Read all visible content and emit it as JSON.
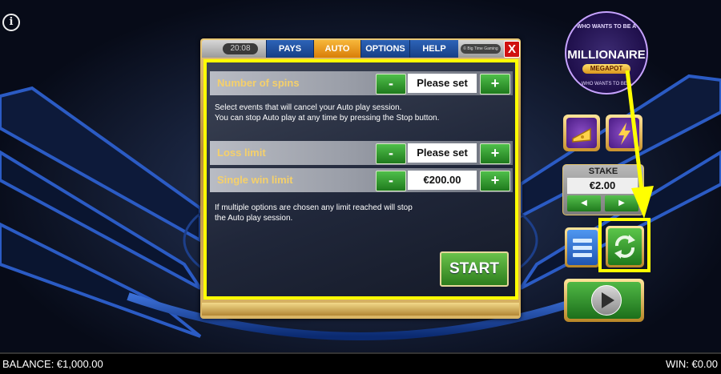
{
  "header": {
    "info_icon": "info-icon"
  },
  "modal": {
    "clock": "20:08",
    "tabs": [
      {
        "label": "PAYS",
        "active": false
      },
      {
        "label": "AUTO",
        "active": true
      },
      {
        "label": "OPTIONS",
        "active": false
      },
      {
        "label": "HELP",
        "active": false
      }
    ],
    "studio": "© Big Time Gaming",
    "close_label": "X",
    "number_of_spins": {
      "label": "Number of spins",
      "value": "Please set"
    },
    "cancel_note": [
      "Select events that will cancel your Auto play session.",
      "You can stop Auto play at any time by pressing the Stop button."
    ],
    "loss_limit": {
      "label": "Loss limit",
      "value": "Please set"
    },
    "single_win_limit": {
      "label": "Single win limit",
      "value": "€200.00"
    },
    "multi_note": [
      "If multiple options are chosen any limit reached will stop",
      "the Auto play session."
    ],
    "minus_label": "-",
    "plus_label": "+",
    "start_label": "START"
  },
  "logo": {
    "top": "WHO WANTS TO BE A",
    "main": "MILLIONAIRE",
    "sub": "MEGAPOT",
    "bottom": "WHO WANTS TO BE A"
  },
  "stake": {
    "label": "STAKE",
    "value": "€2.00"
  },
  "footer": {
    "balance": "BALANCE: €1,000.00",
    "win": "WIN: €0.00"
  },
  "colors": {
    "accent": "#ffff00",
    "green": "#2d7d1c",
    "tab_blue": "#1f4f9e",
    "tab_active": "#f0a020"
  }
}
